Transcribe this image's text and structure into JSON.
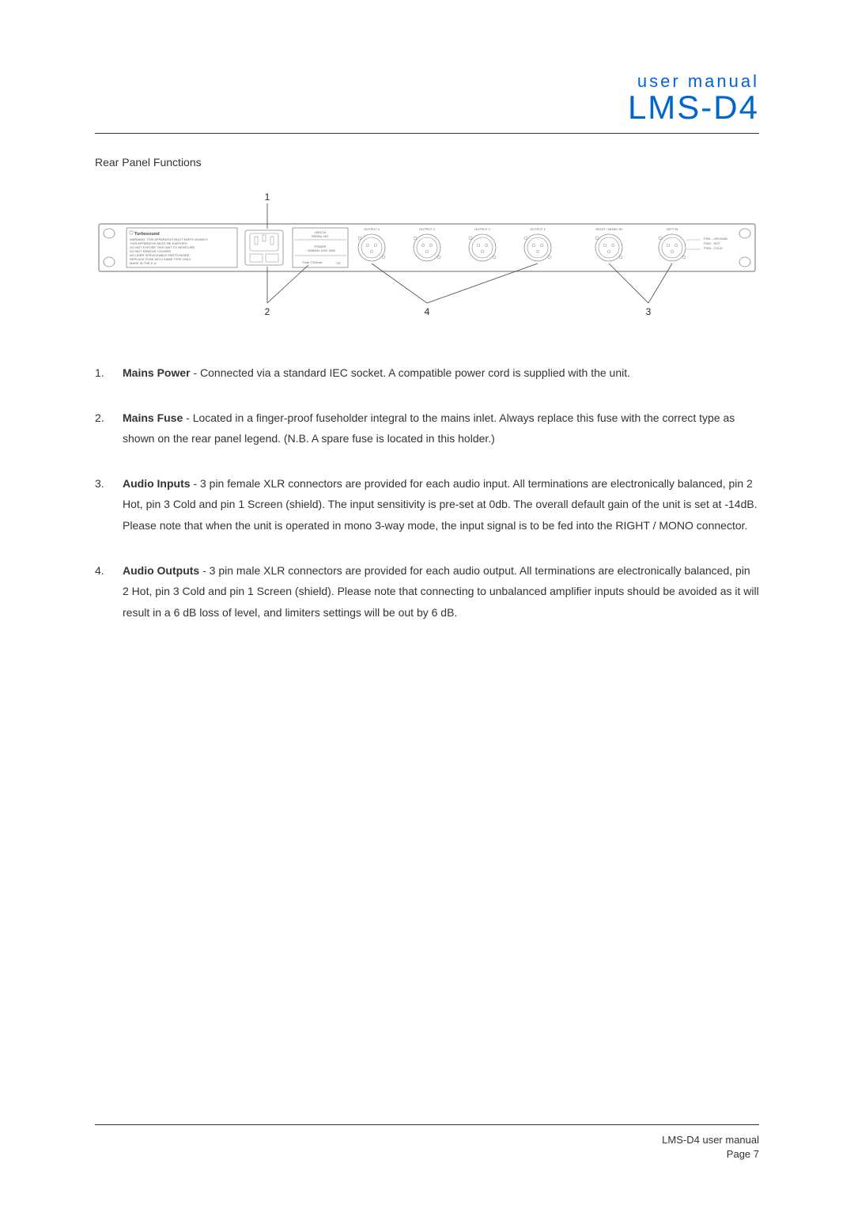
{
  "header": {
    "label": "user manual",
    "title": "LMS-D4"
  },
  "section_heading": "Rear Panel Functions",
  "diagram": {
    "callouts": {
      "c1": "1",
      "c2": "2",
      "c3": "3",
      "c4": "4"
    },
    "brand": "Turbosound",
    "warning": {
      "l1": "WARNING: THIS APPARATUS MUST EARTH ALWAYS",
      "l2": "THIS APPARATUS MUST BE EARTHED",
      "l3": "DO NOT EXPOSE THIS UNIT TO MOISTURE",
      "l4": "DO NOT REMOVE COVERS",
      "l5": "NO USER SERVICEABLE PARTS INSIDE",
      "l6": "REPLACE FUSE WITH SAME TYPE ONLY",
      "l7": "MADE IN THE E.U."
    },
    "model_label1": "LMS-D4",
    "model_label2": "SERIAL NO.",
    "power_label1": "POWER",
    "power_label2": "~ 50/60Hz 100V 20W",
    "fuse_label": "Fuse T315mA",
    "ce": "CE",
    "outputs": {
      "o4": "OUTPUT 4",
      "o3": "OUTPUT 3",
      "o2": "OUTPUT 2",
      "o1": "OUTPUT 1"
    },
    "inputs": {
      "right": "RIGHT / MONO IN",
      "left": "LEFT IN"
    },
    "pins": {
      "l1": "PIN1 - GROUND",
      "l2": "PIN2 - HOT",
      "l3": "PIN3 - COLD"
    }
  },
  "items": [
    {
      "num": "1.",
      "title": "Mains Power",
      "body": " - Connected via a standard IEC socket. A compatible power cord is supplied with the unit."
    },
    {
      "num": "2.",
      "title": "Mains Fuse",
      "body": " - Located in a finger-proof fuseholder integral to the mains inlet. Always replace this fuse with the correct type as shown on the rear panel legend. (N.B. A spare fuse is located in this holder.)"
    },
    {
      "num": "3.",
      "title": "Audio Inputs",
      "body": " - 3 pin female XLR connectors are provided for each audio input. All terminations are electronically balanced, pin 2 Hot, pin 3 Cold and pin 1 Screen (shield). The input sensitivity is pre-set at 0db. The overall default gain of the unit is set at -14dB. Please note that when the unit is operated in mono 3-way mode, the input signal is to be fed into the RIGHT / MONO connector."
    },
    {
      "num": "4.",
      "title": "Audio Outputs",
      "body": " - 3 pin male XLR connectors are provided for each audio output. All terminations are electronically balanced, pin 2 Hot, pin 3 Cold and pin 1 Screen (shield). Please note that connecting to unbalanced amplifier inputs should be avoided as it will result in a 6 dB loss of level, and limiters settings will be out by 6 dB."
    }
  ],
  "footer": {
    "line1": "LMS-D4 user manual",
    "line2": "Page 7"
  }
}
